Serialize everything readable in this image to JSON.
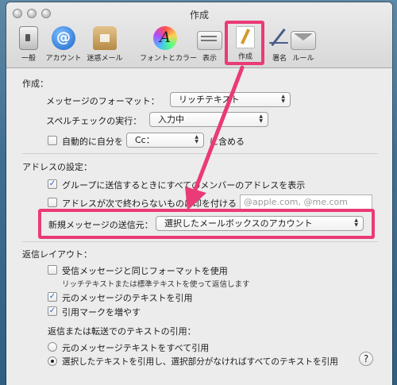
{
  "window": {
    "title": "作成"
  },
  "toolbar": {
    "items": [
      {
        "label": "一般",
        "icon": "general-switch-icon"
      },
      {
        "label": "アカウント",
        "icon": "at-sign-icon"
      },
      {
        "label": "迷惑メール",
        "icon": "junk-mail-bag-icon"
      },
      {
        "label": "フォントとカラー",
        "icon": "fonts-colors-icon"
      },
      {
        "label": "表示",
        "icon": "viewing-icon"
      },
      {
        "label": "作成",
        "icon": "composing-pen-icon",
        "selected": true
      },
      {
        "label": "署名",
        "icon": "signature-pen-icon"
      },
      {
        "label": "ルール",
        "icon": "rules-envelope-icon"
      }
    ]
  },
  "compose": {
    "heading": "作成：",
    "format_label": "メッセージのフォーマット：",
    "format_value": "リッチテキスト",
    "spell_label": "スペルチェックの実行：",
    "spell_value": "入力中",
    "auto_self_pre": "自動的に自分を",
    "auto_self_value": "Cc：",
    "auto_self_post": "に含める"
  },
  "address": {
    "heading": "アドレスの設定：",
    "group_label": "グループに送信するときにすべてのメンバーのアドレスを表示",
    "mark_label": "アドレスが次で終わらないものに印を付ける",
    "mark_placeholder": "@apple.com, @me.com",
    "send_from_label": "新規メッセージの送信元：",
    "send_from_value": "選択したメールボックスのアカウント"
  },
  "reply": {
    "heading": "返信レイアウト：",
    "same_format_label": "受信メッセージと同じフォーマットを使用",
    "same_format_note": "リッチテキストまたは標準テキストを使って返信します",
    "quote_text_label": "元のメッセージのテキストを引用",
    "increase_quote_label": "引用マークを増やす",
    "quoting_heading": "返信または転送でのテキストの引用：",
    "include_all_label": "元のメッセージテキストをすべて引用",
    "include_selected_label": "選択したテキストを引用し、選択部分がなければすべてのテキストを引用",
    "help": "?"
  },
  "colors": {
    "annotation": "#ea3a78",
    "checkmark": "#1d5fc9"
  }
}
